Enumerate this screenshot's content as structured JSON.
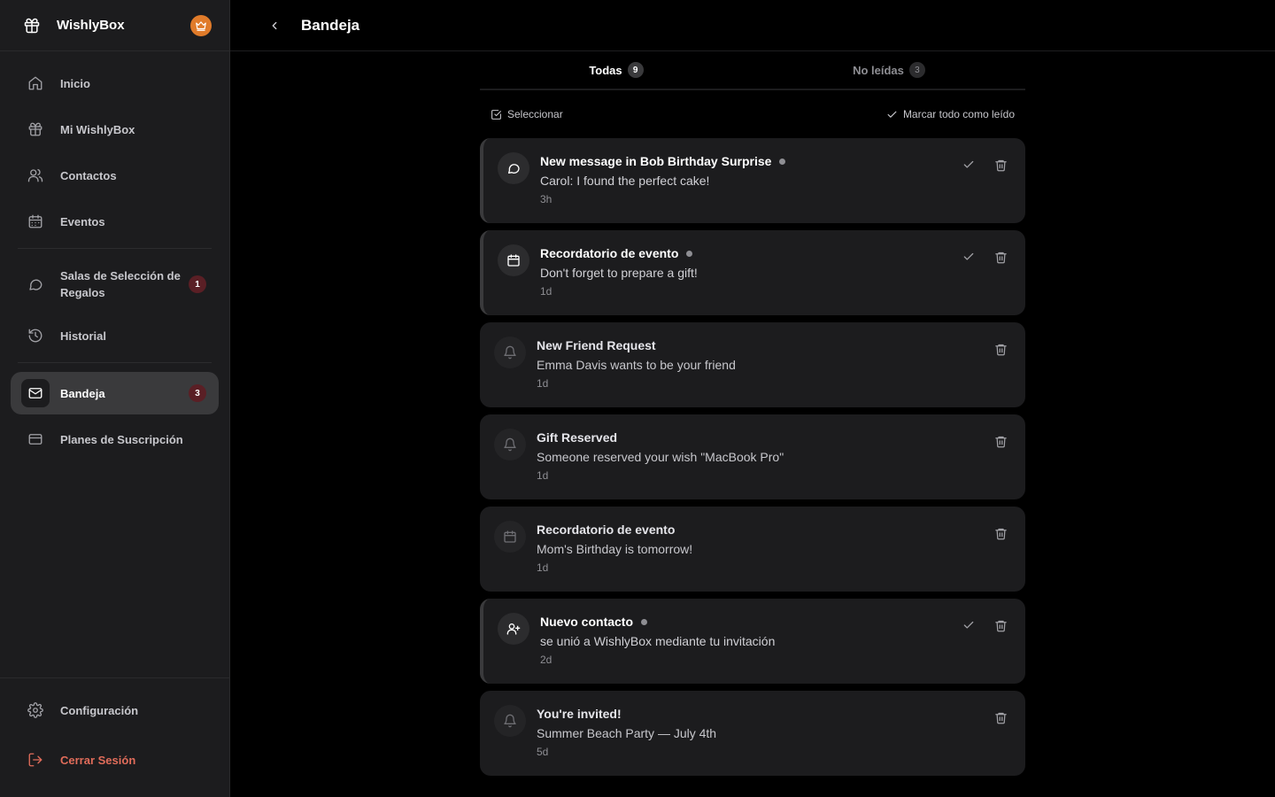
{
  "app": {
    "name": "WishlyBox"
  },
  "sidebar": {
    "items": [
      {
        "label": "Inicio",
        "icon": "home-icon"
      },
      {
        "label": "Mi WishlyBox",
        "icon": "gift-icon"
      },
      {
        "label": "Contactos",
        "icon": "users-icon"
      },
      {
        "label": "Eventos",
        "icon": "calendar-icon"
      },
      {
        "label": "Salas de Selección de Regalos",
        "icon": "chat-icon",
        "badge": "1"
      },
      {
        "label": "Historial",
        "icon": "history-icon"
      },
      {
        "label": "Bandeja",
        "icon": "mail-icon",
        "badge": "3",
        "active": true
      },
      {
        "label": "Planes de Suscripción",
        "icon": "credit-card-icon"
      }
    ],
    "bottom": {
      "settings_label": "Configuración",
      "logout_label": "Cerrar Sesión"
    }
  },
  "header": {
    "title": "Bandeja"
  },
  "tabs": [
    {
      "label": "Todas",
      "count": "9",
      "active": true
    },
    {
      "label": "No leídas",
      "count": "3",
      "active": false
    }
  ],
  "toolbar": {
    "select_label": "Seleccionar",
    "mark_all_label": "Marcar todo como leído"
  },
  "notifications": [
    {
      "title": "New message in Bob Birthday Surprise",
      "message": "Carol: I found the perfect cake!",
      "time": "3h",
      "unread": true,
      "icon": "chat-bubble-icon"
    },
    {
      "title": "Recordatorio de evento",
      "message": "Don't forget to prepare a gift!",
      "time": "1d",
      "unread": true,
      "icon": "calendar-icon"
    },
    {
      "title": "New Friend Request",
      "message": "Emma Davis wants to be your friend",
      "time": "1d",
      "unread": false,
      "icon": "bell-icon"
    },
    {
      "title": "Gift Reserved",
      "message": "Someone reserved your wish \"MacBook Pro\"",
      "time": "1d",
      "unread": false,
      "icon": "bell-icon"
    },
    {
      "title": "Recordatorio de evento",
      "message": "Mom's Birthday is tomorrow!",
      "time": "1d",
      "unread": false,
      "icon": "calendar-icon"
    },
    {
      "title": "Nuevo contacto",
      "message": "se unió a WishlyBox mediante tu invitación",
      "time": "2d",
      "unread": true,
      "icon": "user-plus-icon"
    },
    {
      "title": "You're invited!",
      "message": "Summer Beach Party — July 4th",
      "time": "5d",
      "unread": false,
      "icon": "bell-icon"
    }
  ],
  "colors": {
    "accent_crown": "#e07b2a",
    "badge": "#5a1f25",
    "logout": "#e06c5a"
  }
}
